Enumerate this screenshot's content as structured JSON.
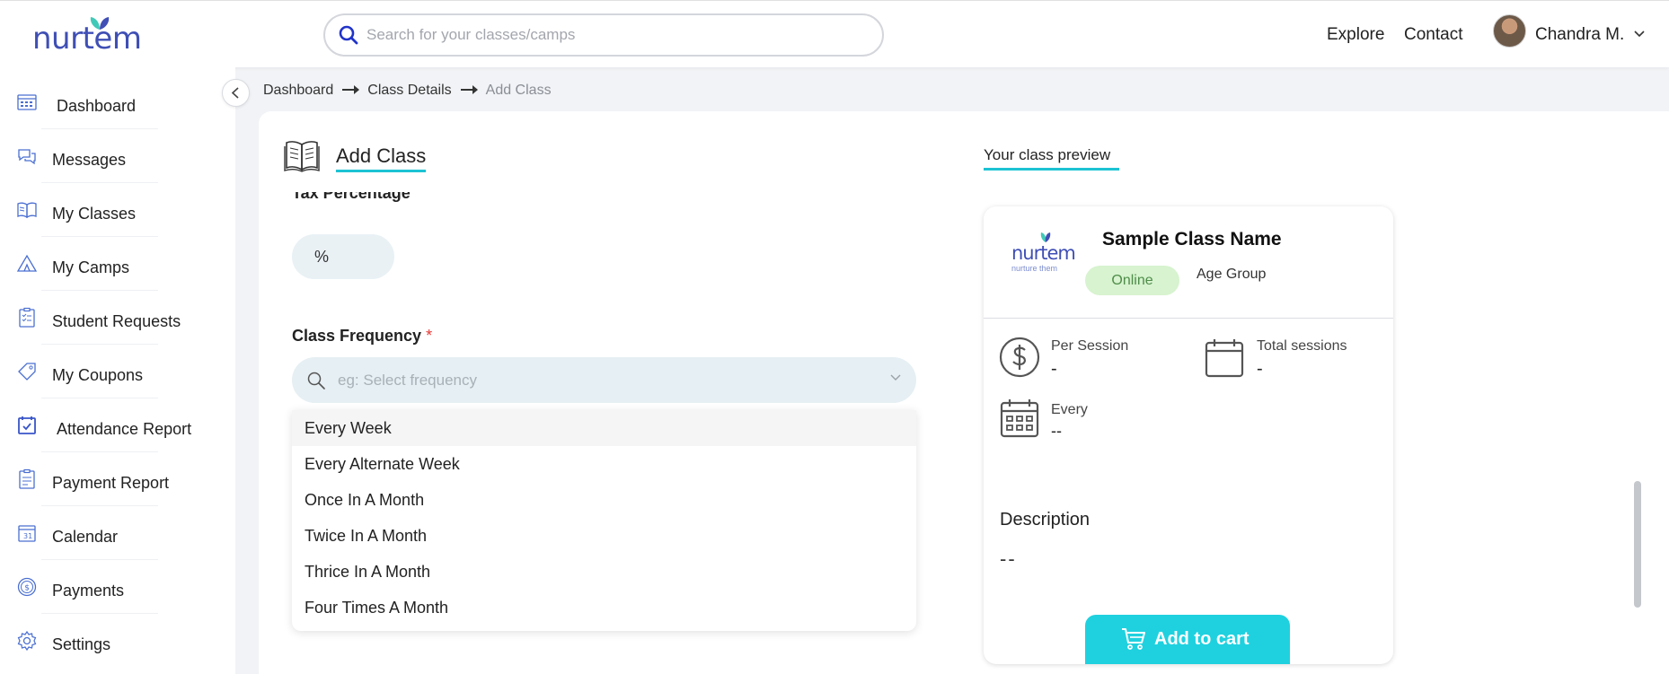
{
  "brand": {
    "logo_text": "nurtem",
    "accent": "#1cc3d3",
    "brand_blue": "#3f4fb5"
  },
  "header": {
    "search_placeholder": "Search for your classes/camps",
    "nav": [
      "Explore",
      "Contact"
    ],
    "user_name": "Chandra M."
  },
  "sidebar": {
    "items": [
      {
        "label": "Dashboard",
        "icon": "dashboard-icon"
      },
      {
        "label": "Messages",
        "icon": "messages-icon"
      },
      {
        "label": "My Classes",
        "icon": "book-icon"
      },
      {
        "label": "My Camps",
        "icon": "tent-icon"
      },
      {
        "label": "Student Requests",
        "icon": "clipboard-icon"
      },
      {
        "label": "My Coupons",
        "icon": "tag-icon"
      },
      {
        "label": "Attendance Report",
        "icon": "calendar-check-icon"
      },
      {
        "label": "Payment Report",
        "icon": "report-icon"
      },
      {
        "label": "Calendar",
        "icon": "calendar-icon"
      },
      {
        "label": "Payments",
        "icon": "dollar-icon"
      },
      {
        "label": "Settings",
        "icon": "gear-icon"
      }
    ]
  },
  "breadcrumb": [
    "Dashboard",
    "Class Details",
    "Add Class"
  ],
  "form": {
    "title": "Add Class",
    "tax_label": "Tax Percentage",
    "tax_suffix": "%",
    "frequency_label": "Class Frequency",
    "required_mark": "*",
    "frequency_placeholder": "eg: Select frequency",
    "frequency_options": [
      "Every Week",
      "Every Alternate Week",
      "Once In A Month",
      "Twice In A Month",
      "Thrice In A Month",
      "Four Times A Month"
    ],
    "highlighted_option": "Every Week"
  },
  "preview": {
    "title": "Your class preview",
    "logo_text": "nurtem",
    "logo_tagline": "nurture them",
    "class_name": "Sample Class Name",
    "mode_badge": "Online",
    "age_group_label": "Age Group",
    "per_session_label": "Per Session",
    "per_session_value": "-",
    "total_sessions_label": "Total sessions",
    "total_sessions_value": "-",
    "every_label": "Every",
    "every_value": "--",
    "description_label": "Description",
    "description_value": "--",
    "add_to_cart": "Add to cart"
  }
}
